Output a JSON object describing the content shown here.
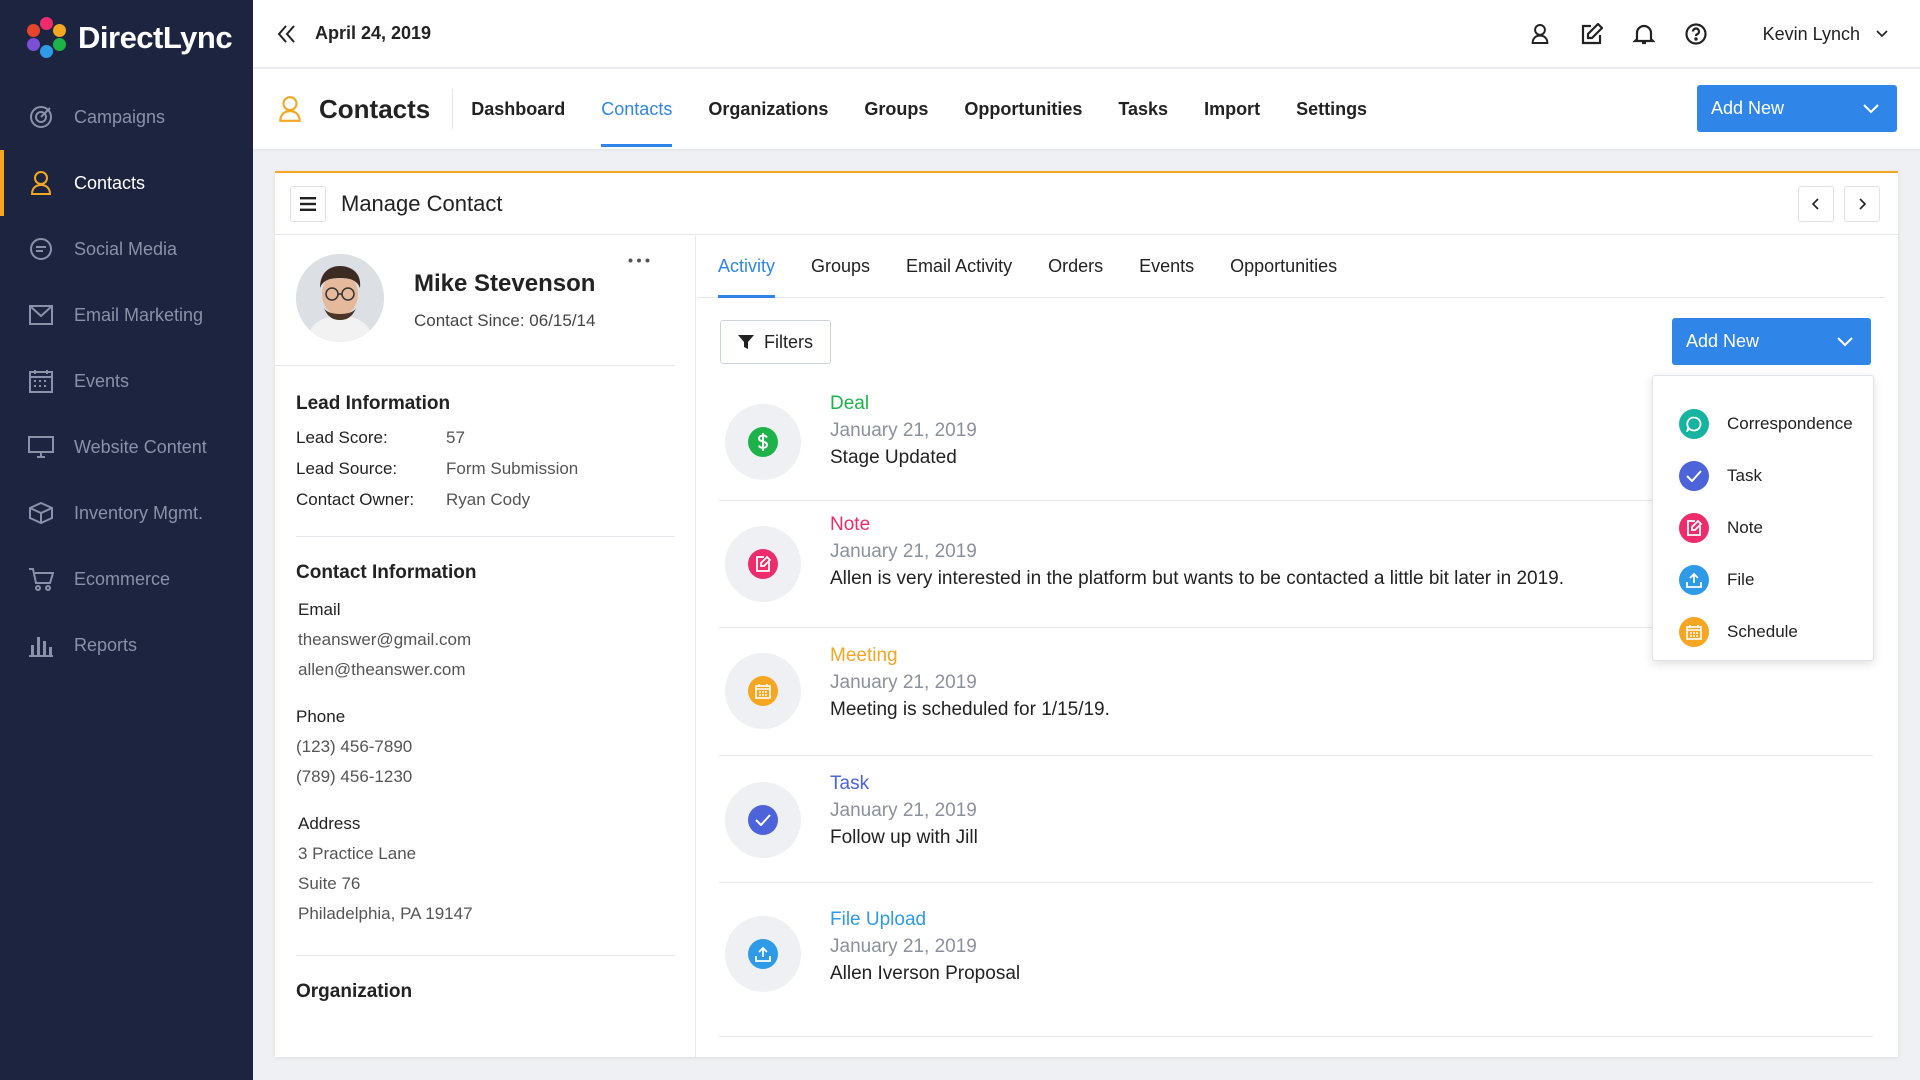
{
  "brand": {
    "name": "DirectLync"
  },
  "sidebar": {
    "items": [
      {
        "label": "Campaigns",
        "icon": "target-icon"
      },
      {
        "label": "Contacts",
        "icon": "user-icon",
        "active": true
      },
      {
        "label": "Social Media",
        "icon": "chat-bubble-icon"
      },
      {
        "label": "Email Marketing",
        "icon": "envelope-icon"
      },
      {
        "label": "Events",
        "icon": "calendar-icon"
      },
      {
        "label": "Website Content",
        "icon": "monitor-icon"
      },
      {
        "label": "Inventory Mgmt.",
        "icon": "box-icon"
      },
      {
        "label": "Ecommerce",
        "icon": "cart-icon"
      },
      {
        "label": "Reports",
        "icon": "bar-chart-icon"
      }
    ]
  },
  "topbar": {
    "date": "April 24, 2019",
    "user": "Kevin Lynch"
  },
  "section": {
    "title": "Contacts",
    "tabs": [
      "Dashboard",
      "Contacts",
      "Organizations",
      "Groups",
      "Opportunities",
      "Tasks",
      "Import",
      "Settings"
    ],
    "active_tab": "Contacts",
    "add_new_label": "Add New"
  },
  "card": {
    "title": "Manage Contact"
  },
  "contact": {
    "name": "Mike Stevenson",
    "since": "Contact Since: 06/15/14",
    "lead": {
      "heading": "Lead Information",
      "score_label": "Lead Score:",
      "score": "57",
      "source_label": "Lead Source:",
      "source": "Form Submission",
      "owner_label": "Contact Owner:",
      "owner": "Ryan Cody"
    },
    "info": {
      "heading": "Contact Information",
      "email_label": "Email",
      "emails": [
        "theanswer@gmail.com",
        "allen@theanswer.com"
      ],
      "phone_label": "Phone",
      "phones": [
        "(123) 456-7890",
        "(789) 456-1230"
      ],
      "address_label": "Address",
      "address": [
        "3 Practice Lane",
        "Suite 76",
        "Philadelphia, PA 19147"
      ]
    },
    "organization_heading": "Organization"
  },
  "activity": {
    "tabs": [
      "Activity",
      "Groups",
      "Email Activity",
      "Orders",
      "Events",
      "Opportunities"
    ],
    "active_tab": "Activity",
    "filters_label": "Filters",
    "add_new_label": "Add New",
    "feed": [
      {
        "type": "Deal",
        "date": "January 21, 2019",
        "desc": "Stage Updated",
        "color": "#1eb24a",
        "icon": "dollar-icon"
      },
      {
        "type": "Note",
        "date": "January 21, 2019",
        "desc": "Allen is very interested in the platform but wants to be contacted a little bit later in 2019.",
        "color": "#ee2c6c",
        "icon": "note-icon"
      },
      {
        "type": "Meeting",
        "date": "January 21, 2019",
        "desc": "Meeting is scheduled for 1/15/19.",
        "color": "#f5a623",
        "icon": "calendar-icon"
      },
      {
        "type": "Task",
        "date": "January 21, 2019",
        "desc": "Follow up with Jill",
        "color": "#4c63d9",
        "icon": "check-icon"
      },
      {
        "type": "File Upload",
        "date": "January 21, 2019",
        "desc": "Allen Iverson Proposal",
        "color": "#2f9be6",
        "icon": "upload-icon"
      }
    ]
  },
  "dropdown": {
    "items": [
      {
        "label": "Correspondence",
        "color": "#16b3a0",
        "icon": "chat-icon"
      },
      {
        "label": "Task",
        "color": "#4c63d9",
        "icon": "check-icon"
      },
      {
        "label": "Note",
        "color": "#ee2c6c",
        "icon": "note-icon"
      },
      {
        "label": "File",
        "color": "#2f9be6",
        "icon": "upload-icon"
      },
      {
        "label": "Schedule",
        "color": "#f5a623",
        "icon": "calendar-icon"
      }
    ]
  }
}
